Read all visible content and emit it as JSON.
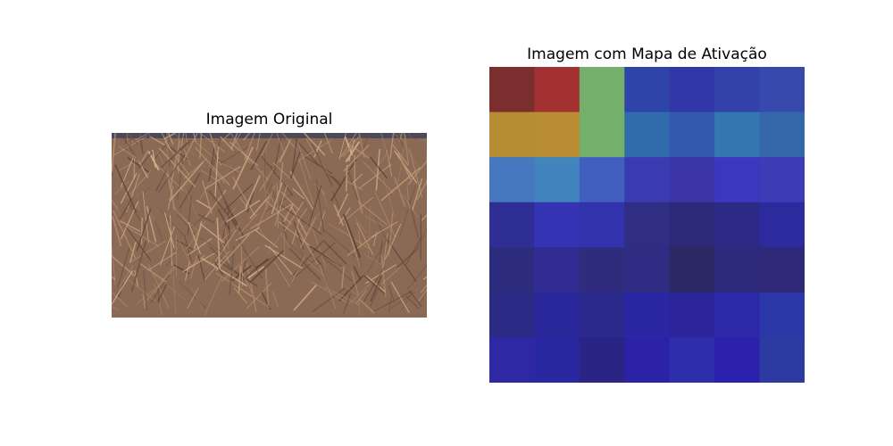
{
  "figure": {
    "left_title": "Imagem Original",
    "right_title": "Imagem com Mapa de Ativação"
  },
  "chart_data": [
    {
      "type": "image",
      "title": "Imagem Original",
      "subject": "dry brown grass",
      "colors": {
        "base": "#8a6a55",
        "light": "#c4a07c",
        "dark": "#5a4236",
        "sky": "#4a4a5a"
      }
    },
    {
      "type": "heatmap",
      "title": "Imagem com Mapa de Ativação",
      "rows": 7,
      "cols": 7,
      "cells": [
        [
          "#7a2e2e",
          "#a33131",
          "#74b06c",
          "#2f44a8",
          "#3237a8",
          "#3342ab",
          "#3749ad"
        ],
        [
          "#b78d33",
          "#b98d34",
          "#73b06c",
          "#306cac",
          "#3159ae",
          "#3277b2",
          "#3466aa"
        ],
        [
          "#4578bf",
          "#4184be",
          "#425fbf",
          "#3b3bb1",
          "#3b35a7",
          "#3c38bd",
          "#3d3bb6"
        ],
        [
          "#2f2e94",
          "#3434b4",
          "#3033ab",
          "#2f2e82",
          "#2c2a78",
          "#2d2a86",
          "#2d2a9d"
        ],
        [
          "#2e2c7e",
          "#302c92",
          "#2f2c7e",
          "#2f2c84",
          "#2b2863",
          "#2c2a7b",
          "#2f2878"
        ],
        [
          "#2b2b86",
          "#2a289a",
          "#2c2a8d",
          "#2b26a4",
          "#2b249a",
          "#2c28a8",
          "#2c37a8"
        ],
        [
          "#2e28a4",
          "#2a28a0",
          "#2a2584",
          "#2c22a8",
          "#2c2eab",
          "#2c21ac",
          "#2c3aa2"
        ]
      ]
    }
  ]
}
